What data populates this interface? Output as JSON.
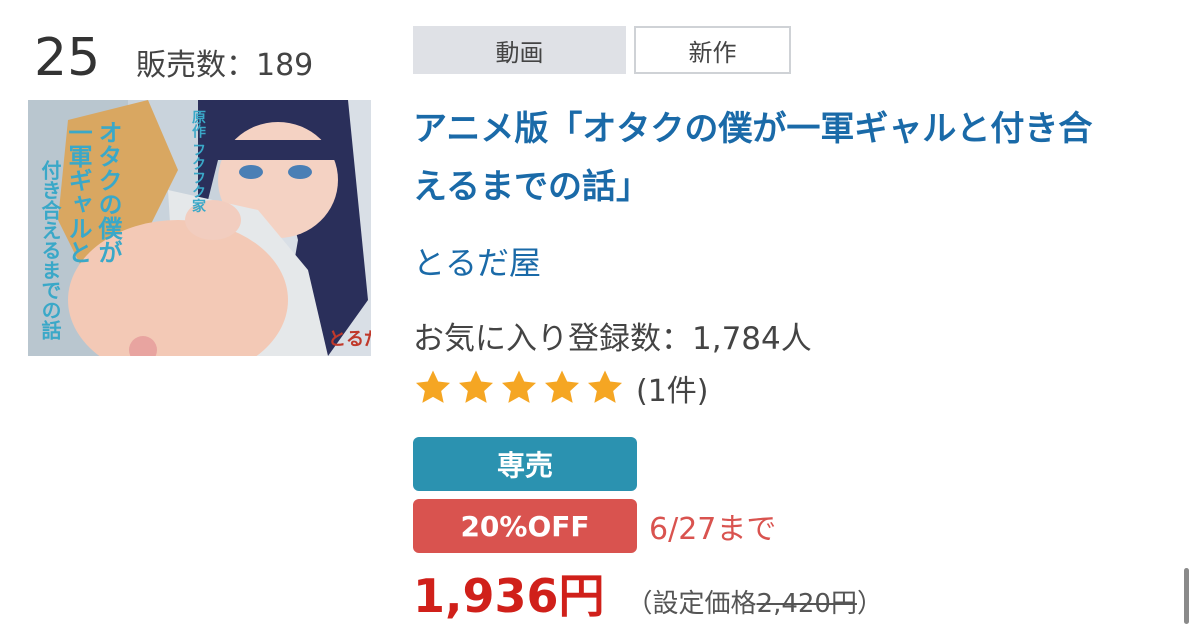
{
  "rank": "25",
  "sales_label": "販売数：189",
  "tags": {
    "category": "動画",
    "new": "新作"
  },
  "product": {
    "title_line1": "アニメ版「オタクの僕が一軍ギャルと付き合",
    "title_line2": "えるまでの話」",
    "circle": "とるだ屋",
    "favorites": "お気に入り登録数：1,784人",
    "rating": 5,
    "review_count": "(1件)"
  },
  "thumbnail": {
    "text_vertical_1": "オタクの僕が",
    "text_vertical_2": "一軍ギャルと",
    "text_vertical_3": "付き合えるまでの話",
    "text_original": "原作 フクフク家",
    "text_logo": "とるだ屋"
  },
  "badges": {
    "exclusive": "専売",
    "discount": "20%OFF",
    "deadline": "6/27まで"
  },
  "price": {
    "current": "1,936円",
    "list_prefix": "（設定価格",
    "list_value": "2,420円",
    "list_suffix": "）"
  },
  "colors": {
    "link": "#1a6aa8",
    "exclusive": "#2b92b0",
    "discount": "#d9534f",
    "price": "#d0201a",
    "star": "#f5a623"
  }
}
